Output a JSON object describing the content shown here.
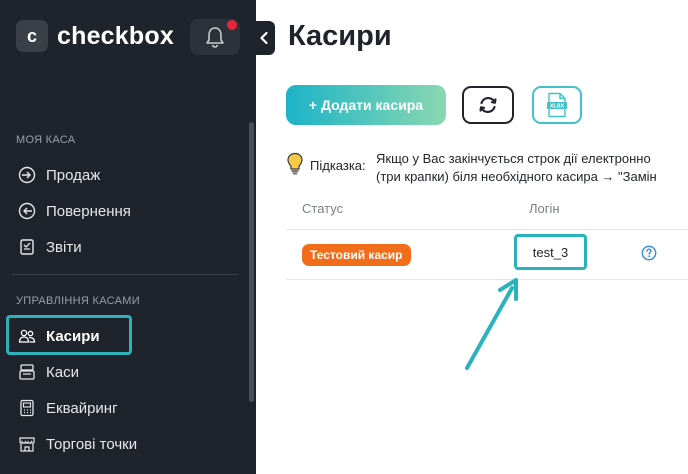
{
  "app": {
    "logo_letter": "c",
    "logo_text": "checkbox"
  },
  "sidebar": {
    "section1_title": "МОЯ КАСА",
    "section1_items": [
      {
        "label": "Продаж",
        "icon": "login-arrow-icon"
      },
      {
        "label": "Повернення",
        "icon": "return-arrow-icon"
      },
      {
        "label": "Звіти",
        "icon": "report-icon"
      }
    ],
    "section2_title": "УПРАВЛІННЯ КАСАМИ",
    "section2_items": [
      {
        "label": "Касири",
        "icon": "users-icon",
        "active": true
      },
      {
        "label": "Каси",
        "icon": "cash-register-icon"
      },
      {
        "label": "Еквайринг",
        "icon": "pos-terminal-icon"
      },
      {
        "label": "Торгові точки",
        "icon": "store-icon"
      }
    ]
  },
  "main": {
    "title": "Касири",
    "add_button": "+ Додати касира",
    "xlsx_label": "XLSX",
    "hint_label": "Підказка:",
    "hint_line1": "Якщо у Вас закінчується строк дії електронно",
    "hint_line2": "(три крапки) біля необхідного касира → \"Замін",
    "table": {
      "headers": [
        "Статус",
        "Логін"
      ],
      "rows": [
        {
          "status": "Тестовий касир",
          "login": "test_3"
        }
      ]
    }
  },
  "colors": {
    "accent": "#2bb3bd",
    "status_badge": "#f26d1a",
    "sidebar_bg": "#1f232b",
    "notification": "#e5263c"
  }
}
